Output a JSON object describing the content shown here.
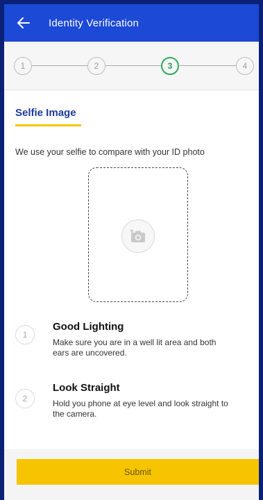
{
  "header": {
    "back_icon": "arrow-left-icon",
    "title": "Identity Verification"
  },
  "stepper": {
    "steps": [
      "1",
      "2",
      "3",
      "4"
    ],
    "active_step": 3,
    "active_color": "#2eaa5c"
  },
  "section": {
    "title": "Selfie Image",
    "description": "We use your selfie to compare with your ID photo"
  },
  "selfie": {
    "icon": "add-photo-camera-icon"
  },
  "tips": [
    {
      "number": "1",
      "title": "Good Lighting",
      "line1": "Make sure you are in a well lit area and both",
      "line2": "ears are uncovered."
    },
    {
      "number": "2",
      "title": "Look Straight",
      "line1": "Hold you phone at eye level and look straight to",
      "line2": "the camera."
    }
  ],
  "footer": {
    "submit_label": "Submit"
  },
  "colors": {
    "app_bar": "#1c49d6",
    "accent_yellow": "#f5c400",
    "section_title": "#1a3b9a",
    "outer_border": "#0b2176"
  }
}
